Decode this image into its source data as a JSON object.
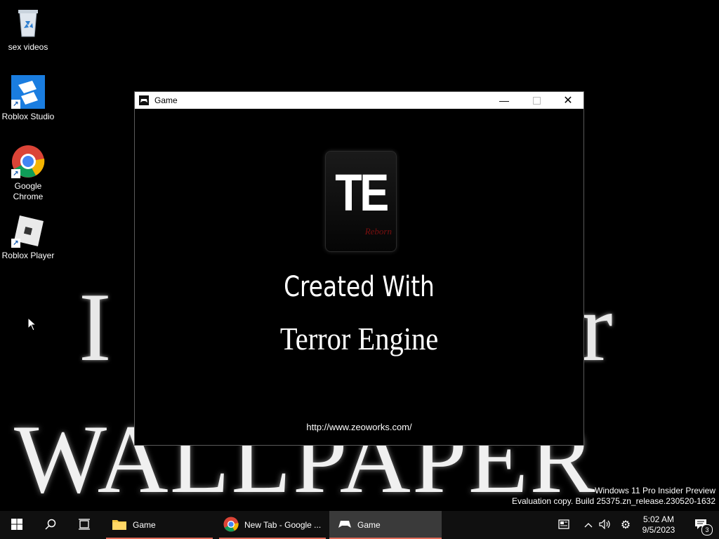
{
  "desktop": {
    "icons": [
      {
        "label": "sex videos",
        "icon": "recycle-bin-icon"
      },
      {
        "label": "Roblox Studio",
        "icon": "roblox-studio-icon"
      },
      {
        "label": "Google Chrome",
        "icon": "chrome-icon"
      },
      {
        "label": "Roblox Player",
        "icon": "roblox-player-icon"
      }
    ],
    "wallpaper_line1_left": "I",
    "wallpaper_line1_right": "r",
    "wallpaper_line2": "WALLPAPER",
    "watermark_line1": "Windows 11 Pro Insider Preview",
    "watermark_line2": "Evaluation copy. Build 25375.zn_release.230520-1632"
  },
  "window": {
    "title": "Game",
    "logo_text": "TE",
    "logo_subtext": "Reborn",
    "created_with": "Created With",
    "engine_name": "Terror Engine",
    "url": "http://www.zeoworks.com/"
  },
  "taskbar": {
    "apps": [
      {
        "label": "Game",
        "icon": "folder-icon"
      },
      {
        "label": "New Tab - Google ...",
        "icon": "chrome-icon"
      },
      {
        "label": "Game",
        "icon": "gamepad-icon"
      }
    ],
    "time": "5:02 AM",
    "date": "9/5/2023",
    "notification_count": "3"
  },
  "colors": {
    "taskbar_bg": "#101010",
    "active_app_bg": "#3a3a3a",
    "underline": "#e06c5a"
  }
}
